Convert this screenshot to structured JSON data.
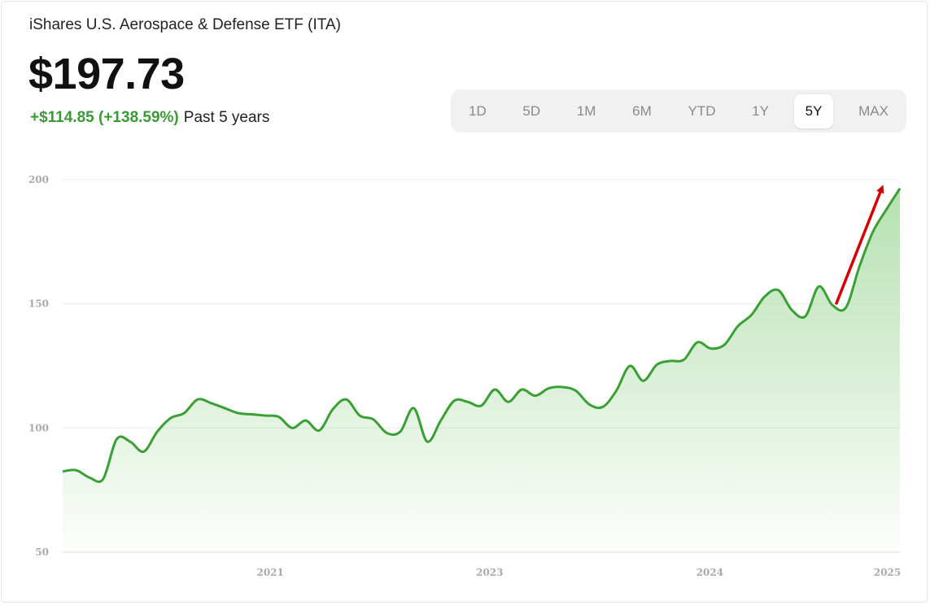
{
  "header": {
    "title": "iShares U.S. Aerospace & Defense ETF (ITA)",
    "price": "$197.73",
    "change": "+$114.85 (+138.59%)",
    "period": "Past 5 years"
  },
  "range_selector": {
    "options": [
      "1D",
      "5D",
      "1M",
      "6M",
      "YTD",
      "1Y",
      "5Y",
      "MAX"
    ],
    "active": "5Y"
  },
  "colors": {
    "line": "#3a9f35",
    "fill": "#a9dba2",
    "arrow": "#d40000",
    "gain_text": "#3a9a35"
  },
  "chart_data": {
    "type": "area",
    "title": "",
    "xlabel": "",
    "ylabel": "",
    "ylim": [
      50,
      200
    ],
    "y_ticks": [
      200,
      150,
      100,
      50
    ],
    "x_ticks": [
      "2021",
      "2023",
      "2024",
      "2025"
    ],
    "grid": true,
    "series": [
      {
        "values": [
          82.5,
          83.0,
          80.0,
          79.5,
          95.5,
          94.5,
          90.5,
          98.5,
          104.0,
          106.0,
          111.5,
          110.0,
          108.0,
          106.0,
          105.5,
          105.0,
          104.5,
          100.0,
          103.0,
          99.0,
          107.5,
          111.5,
          105.0,
          103.5,
          98.0,
          98.5,
          108.0,
          94.5,
          103.0,
          111.0,
          110.5,
          109.0,
          115.5,
          110.5,
          115.5,
          113.0,
          116.0,
          116.5,
          115.0,
          109.5,
          108.5,
          115.0,
          125.0,
          119.0,
          125.5,
          127.0,
          127.5,
          134.5,
          132.0,
          133.5,
          141.0,
          145.5,
          153.0,
          155.5,
          147.5,
          145.0,
          157.0,
          149.5,
          148.5,
          165.0,
          179.0,
          188.0,
          196.5
        ]
      }
    ],
    "annotation": "upward-trend-arrow"
  }
}
